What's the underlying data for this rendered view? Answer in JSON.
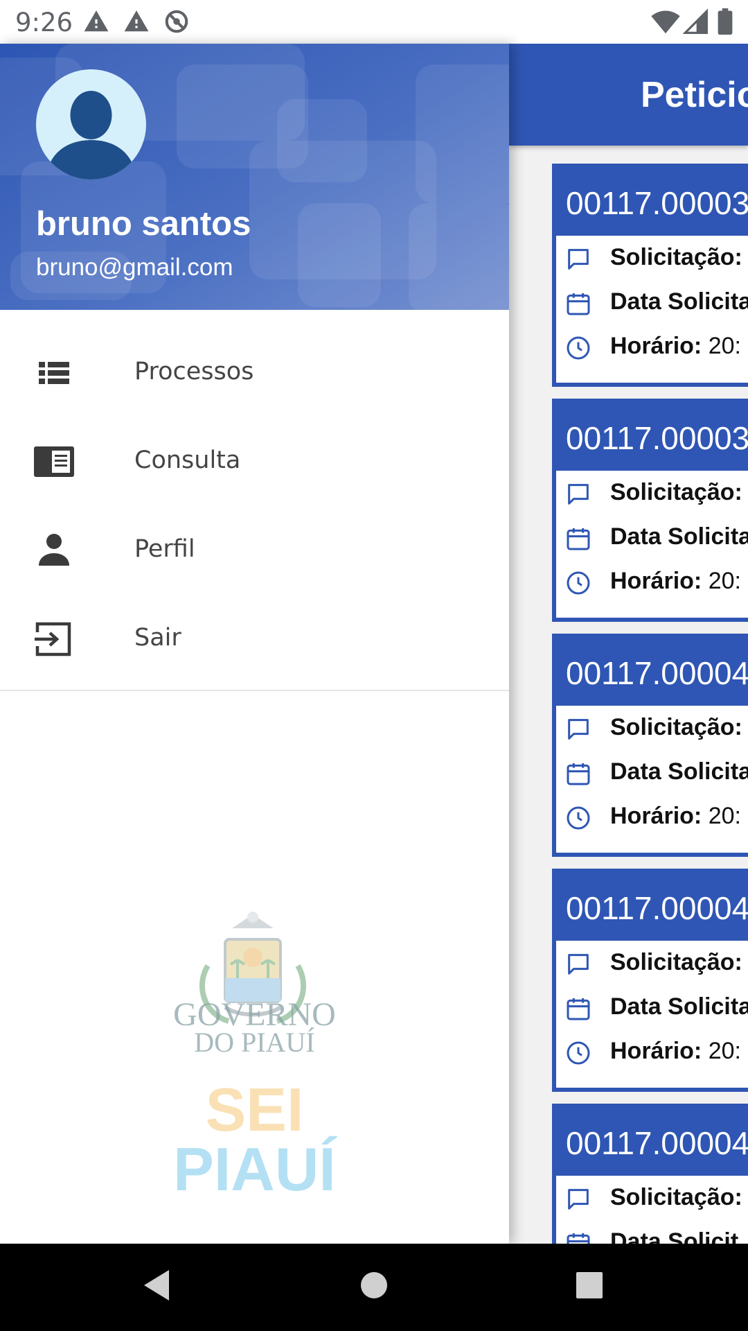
{
  "status_bar": {
    "time": "9:26",
    "left_icons": [
      "warning-icon",
      "warning-icon",
      "sync-disabled-icon"
    ],
    "right_icons": [
      "wifi-icon",
      "signal-icon",
      "battery-icon"
    ]
  },
  "drawer": {
    "user": {
      "name": "bruno santos",
      "email": "bruno@gmail.com",
      "avatar_icon": "person-avatar-icon"
    },
    "menu": [
      {
        "label": "Processos",
        "icon": "list-icon"
      },
      {
        "label": "Consulta",
        "icon": "document-icon"
      },
      {
        "label": "Perfil",
        "icon": "person-icon"
      },
      {
        "label": "Sair",
        "icon": "exit-icon"
      }
    ],
    "branding": {
      "gov_line1": "GOVERNO",
      "gov_line2": "DO PIAUÍ",
      "sei_line1": "SEI",
      "sei_line2": "PIAUÍ"
    }
  },
  "background_screen": {
    "title": "Peticio",
    "cards": [
      {
        "number": "00117.00003",
        "rows": [
          {
            "label": "Solicitação:",
            "value": ""
          },
          {
            "label": "Data Solicita",
            "value": ""
          },
          {
            "label": "Horário:",
            "value": "20:"
          }
        ]
      },
      {
        "number": "00117.00003",
        "rows": [
          {
            "label": "Solicitação:",
            "value": ""
          },
          {
            "label": "Data Solicita",
            "value": ""
          },
          {
            "label": "Horário:",
            "value": "20:"
          }
        ]
      },
      {
        "number": "00117.00004",
        "rows": [
          {
            "label": "Solicitação:",
            "value": ""
          },
          {
            "label": "Data Solicita",
            "value": ""
          },
          {
            "label": "Horário:",
            "value": "20:"
          }
        ]
      },
      {
        "number": "00117.00004",
        "rows": [
          {
            "label": "Solicitação:",
            "value": ""
          },
          {
            "label": "Data Solicita",
            "value": ""
          },
          {
            "label": "Horário:",
            "value": "20:"
          }
        ]
      },
      {
        "number": "00117.00004",
        "rows": [
          {
            "label": "Solicitação:",
            "value": ""
          },
          {
            "label": "Data Solicit",
            "value": ""
          }
        ]
      }
    ]
  },
  "colors": {
    "primary": "#2f56b4",
    "drawer_text": "#454545",
    "icon": "#3b3b3b"
  }
}
